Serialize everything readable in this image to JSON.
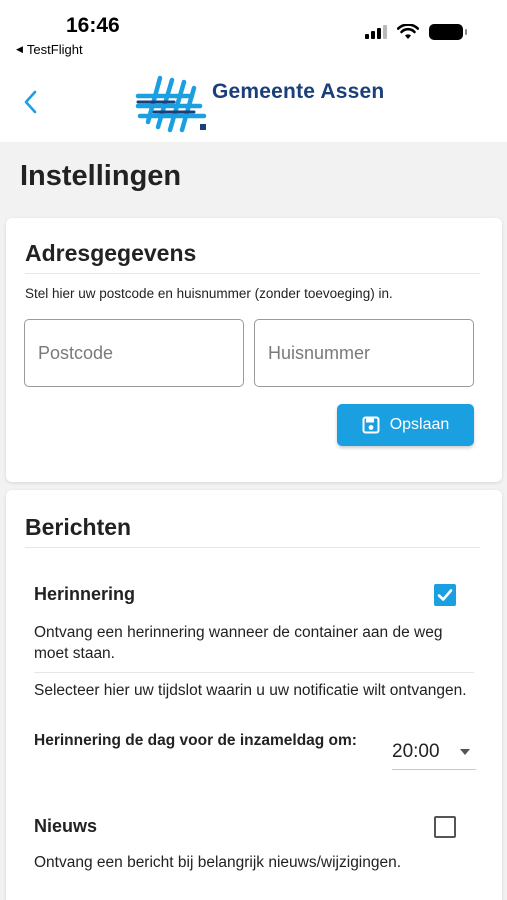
{
  "status_bar": {
    "time": "16:46",
    "back_app": "TestFlight"
  },
  "header": {
    "logo_text": "Gemeente Assen",
    "brand_colors": {
      "navy": "#1b3f7a",
      "blue": "#1a9fe0"
    }
  },
  "page": {
    "title": "Instellingen"
  },
  "address": {
    "title": "Adresgegevens",
    "hint": "Stel hier uw postcode en huisnummer (zonder toevoeging) in.",
    "postcode_placeholder": "Postcode",
    "postcode_value": "",
    "huisnummer_placeholder": "Huisnummer",
    "huisnummer_value": "",
    "save_label": "Opslaan",
    "save_icon": "floppy-disk-icon"
  },
  "messages": {
    "title": "Berichten",
    "reminder": {
      "label": "Herinnering",
      "checked": true,
      "description": "Ontvang een herinnering wanneer de container aan de weg moet staan.",
      "timeslot_hint": "Selecteer hier uw tijdslot waarin u uw notificatie wilt ontvangen.",
      "time_label": "Herinnering de dag voor de inzameldag om:",
      "time_value": "20:00"
    },
    "news": {
      "label": "Nieuws",
      "checked": false,
      "description": "Ontvang een bericht bij belangrijk nieuws/wijzigingen."
    }
  }
}
